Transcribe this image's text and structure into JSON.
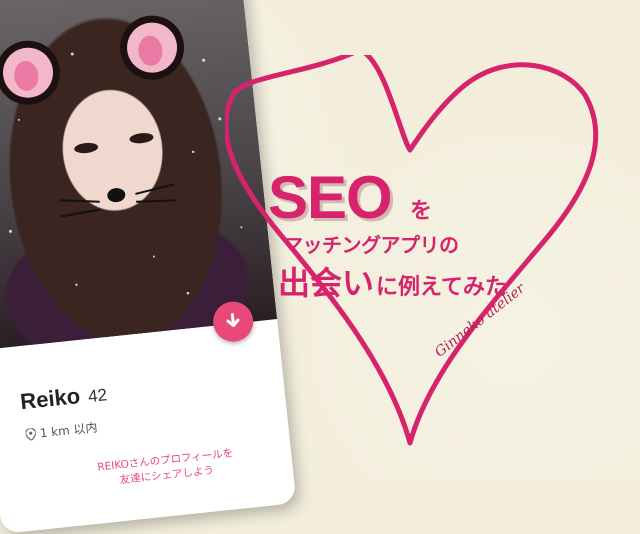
{
  "profile": {
    "name": "Reiko",
    "age": "42",
    "distance": "1 km 以内",
    "share_line1": "REIKOさんのプロフィールを",
    "share_line2": "友達にシェアしよう"
  },
  "headline": {
    "seo": "SEO",
    "particle": "を",
    "line2": "マッチングアプリの",
    "line3_big": "出会い",
    "line3_rest": "に例えてみた"
  },
  "signature": "Ginneko atelier",
  "icons": {
    "cta": "arrow-down-icon",
    "location": "map-pin-icon"
  },
  "colors": {
    "brand_pink": "#d6236c",
    "cta_pink": "#e8497a",
    "background": "#f3eedb"
  }
}
